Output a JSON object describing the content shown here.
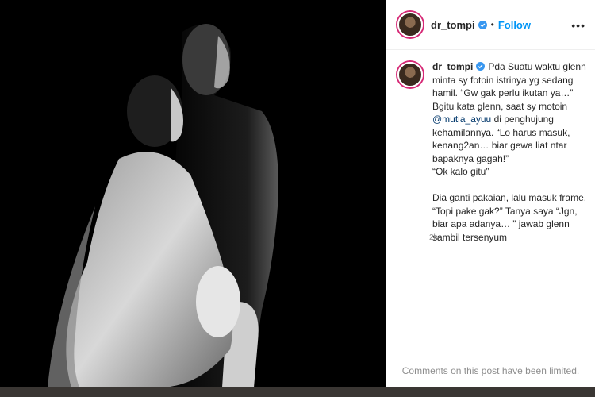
{
  "post": {
    "username": "dr_tompi",
    "follow_label": "Follow",
    "dot": "•",
    "more_label": "•••",
    "caption": {
      "username": "dr_tompi",
      "part1": "Pda Suatu waktu glenn minta sy fotoin istrinya yg sedang hamil. “Gw gak perlu ikutan ya…” Bgitu kata glenn, saat sy motoin ",
      "mention": "@mutia_ayuu",
      "part2": " di penghujung kehamilannya. “Lo harus masuk, kenang2an… biar gewa liat ntar bapaknya gagah!”\n“Ok kalo gitu”\n\nDia ganti pakaian, lalu masuk frame. “Topi pake gak?” Tanya saya “Jgn, biar apa adanya… ” jawab glenn sambil tersenyum"
    },
    "time": "2h",
    "comments_limited": "Comments on this post have been limited."
  },
  "colors": {
    "follow": "#0095f6",
    "mention": "#00376b",
    "story_ring": "#d62976"
  }
}
